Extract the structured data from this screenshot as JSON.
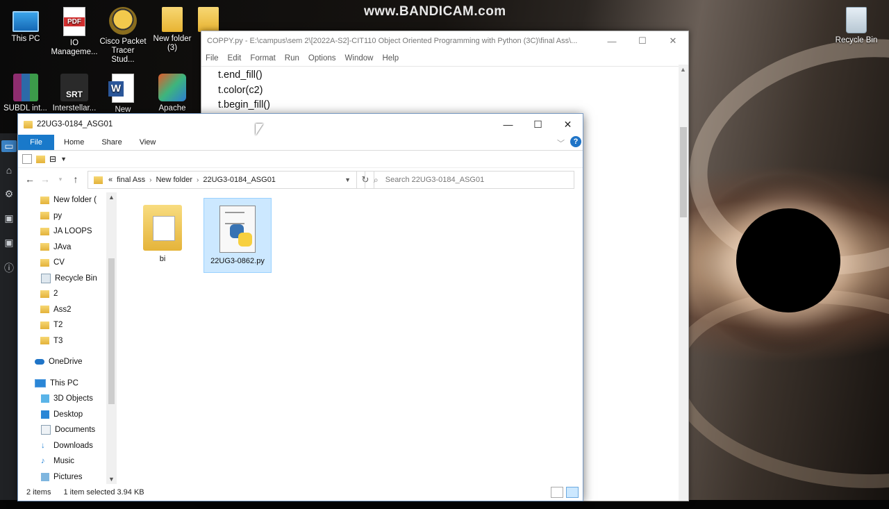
{
  "watermark": {
    "text": "www.BANDICAM.com"
  },
  "desktop": {
    "icons": [
      {
        "label": "This PC",
        "icon": "this-pc-icon"
      },
      {
        "label": "IO Manageme...",
        "icon": "pdf-icon"
      },
      {
        "label": "Cisco Packet Tracer Stud...",
        "icon": "cisco-packet-tracer-icon"
      },
      {
        "label": "New folder (3)",
        "icon": "folder-icon"
      },
      {
        "label": "SUBDL",
        "icon": "winrar-icon"
      },
      {
        "label": "int...",
        "icon": "app-icon"
      },
      {
        "label": "Interstellar...",
        "icon": "srt-file-icon"
      },
      {
        "label": "New",
        "icon": "word-icon"
      },
      {
        "label": "Apache",
        "icon": "apache-icon"
      },
      {
        "label": "Recycle Bin",
        "icon": "recycle-bin-icon"
      }
    ],
    "srt_text": "SRT"
  },
  "idle": {
    "title": "COPPY.py - E:\\campus\\sem 2\\[2022A-S2]-CIT110 Object Oriented Programming with Python (3C)\\final Ass\\...",
    "menu": [
      "File",
      "Edit",
      "Format",
      "Run",
      "Options",
      "Window",
      "Help"
    ],
    "code_lines": [
      "t.end_fill()",
      "t.color(c2)",
      "t.begin_fill()"
    ],
    "minimize": "—",
    "maximize": "☐",
    "close": "✕"
  },
  "explorer": {
    "title": "22UG3-0184_ASG01",
    "ribbon": {
      "file": "File",
      "tabs": [
        "Home",
        "Share",
        "View"
      ],
      "help": "?"
    },
    "breadcrumb": {
      "prefix": "«",
      "parts": [
        "final Ass",
        "New folder",
        "22UG3-0184_ASG01"
      ]
    },
    "search_placeholder": "Search 22UG3-0184_ASG01",
    "nav": {
      "quick_access": [
        {
          "label": "New folder (",
          "pinned": true
        },
        {
          "label": "py",
          "pinned": true
        },
        {
          "label": "JA LOOPS",
          "pinned": true
        },
        {
          "label": "JAva",
          "pinned": true
        },
        {
          "label": "CV",
          "pinned": true
        },
        {
          "label": "Recycle Bin",
          "pinned": true
        },
        {
          "label": "2",
          "pinned": false
        },
        {
          "label": "Ass2",
          "pinned": false
        },
        {
          "label": "T2",
          "pinned": false
        },
        {
          "label": "T3",
          "pinned": false
        }
      ],
      "onedrive": "OneDrive",
      "this_pc": "This PC",
      "this_pc_items": [
        "3D Objects",
        "Desktop",
        "Documents",
        "Downloads",
        "Music",
        "Pictures"
      ]
    },
    "files": [
      {
        "name": "bi",
        "type": "folder",
        "selected": false
      },
      {
        "name": "22UG3-0862.py",
        "type": "python",
        "selected": true
      }
    ],
    "status": {
      "count": "2 items",
      "selected": "1 item selected  3.94 KB"
    }
  }
}
